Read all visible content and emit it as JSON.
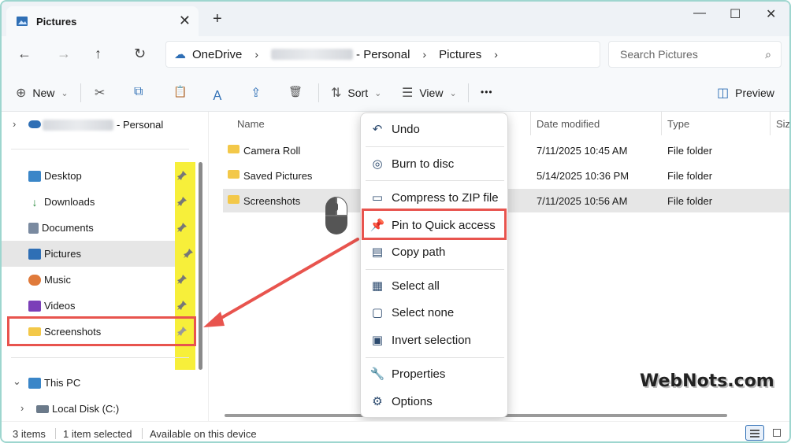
{
  "titlebar": {
    "tab_title": "Pictures",
    "close_glyph": "✕",
    "new_tab_glyph": "+",
    "minimize_glyph": "—",
    "maximize_glyph": "☐",
    "close_window_glyph": "✕"
  },
  "address": {
    "back_glyph": "←",
    "forward_glyph": "→",
    "up_glyph": "↑",
    "refresh_glyph": "↻",
    "crumbs": [
      "OneDrive",
      "- Personal",
      "Pictures"
    ],
    "sep_glyph": "›",
    "cloud_glyph": "☁",
    "search_placeholder": "Search Pictures",
    "search_glyph": "⌕"
  },
  "toolbar": {
    "new_label": "New",
    "new_glyph": "⊕",
    "cut_glyph": "✂",
    "copy_glyph": "⧉",
    "paste_glyph": "📋",
    "rename_glyph": "Ａ",
    "share_glyph": "⇪",
    "delete_glyph": "🗑",
    "sort_label": "Sort",
    "sort_glyph": "⇅",
    "view_label": "View",
    "view_glyph": "☰",
    "more_glyph": "•••",
    "preview_label": "Preview",
    "preview_glyph": "◫",
    "chevron": "⌄"
  },
  "sidebar": {
    "top_label": "- Personal",
    "items": [
      {
        "label": "Desktop",
        "color": "#3a86c8"
      },
      {
        "label": "Downloads",
        "color": "#2b8a3e"
      },
      {
        "label": "Documents",
        "color": "#7a8aa0"
      },
      {
        "label": "Pictures",
        "color": "#2f6fb5"
      },
      {
        "label": "Music",
        "color": "#e07a3a"
      },
      {
        "label": "Videos",
        "color": "#7b3fb8"
      },
      {
        "label": "Screenshots",
        "color": "#f3c849"
      }
    ],
    "this_pc": "This PC",
    "local_disk": "Local Disk (C:)",
    "expand_glyph": "›",
    "expanded_glyph": "⌄"
  },
  "columns": {
    "name": "Name",
    "date_modified": "Date modified",
    "type": "Type",
    "size": "Size"
  },
  "files": [
    {
      "name": "Camera Roll",
      "date": "7/11/2025 10:45 AM",
      "type": "File folder"
    },
    {
      "name": "Saved Pictures",
      "date": "5/14/2025 10:36 PM",
      "type": "File folder"
    },
    {
      "name": "Screenshots",
      "date": "7/11/2025 10:56 AM",
      "type": "File folder"
    }
  ],
  "context_menu": {
    "items": [
      {
        "label": "Undo",
        "icon": "↶"
      },
      {
        "label": "Burn to disc",
        "icon": "◎"
      },
      {
        "label": "Compress to ZIP file",
        "icon": "▭"
      },
      {
        "label": "Pin to Quick access",
        "icon": "📌"
      },
      {
        "label": "Copy path",
        "icon": "▤"
      },
      {
        "label": "Select all",
        "icon": "▦"
      },
      {
        "label": "Select none",
        "icon": "▢"
      },
      {
        "label": "Invert selection",
        "icon": "▣"
      },
      {
        "label": "Properties",
        "icon": "🔧"
      },
      {
        "label": "Options",
        "icon": "⚙"
      }
    ]
  },
  "status": {
    "count": "3 items",
    "selected": "1 item selected",
    "availability": "Available on this device"
  },
  "watermark": "WebNots.com",
  "colors": {
    "highlight_box": "#e8544e",
    "pin_highlight": "#f7ef3a",
    "accent": "#2f6fb5"
  }
}
